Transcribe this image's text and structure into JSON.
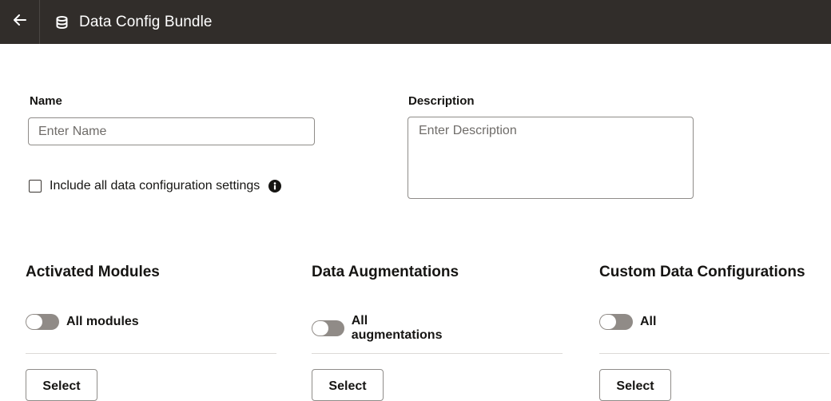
{
  "header": {
    "back_icon": "arrow-left-icon",
    "title_icon": "database-icon",
    "title": "Data Config Bundle"
  },
  "form": {
    "name_label": "Name",
    "name_placeholder": "Enter Name",
    "name_value": "",
    "description_label": "Description",
    "description_placeholder": "Enter Description",
    "description_value": "",
    "include_all_label": "Include all data configuration settings",
    "include_all_checked": false,
    "info_icon": "info-icon"
  },
  "sections": {
    "modules": {
      "title": "Activated Modules",
      "toggle_label": "All modules",
      "toggle_on": false,
      "select_label": "Select"
    },
    "augmentations": {
      "title": "Data Augmentations",
      "toggle_label": "All augmentations",
      "toggle_on": false,
      "select_label": "Select"
    },
    "custom": {
      "title": "Custom Data Configurations",
      "toggle_label": "All",
      "toggle_on": false,
      "select_label": "Select"
    }
  },
  "colors": {
    "header_bg": "#312d2a",
    "toggle_off": "#908b87",
    "border": "#8f8c89"
  }
}
